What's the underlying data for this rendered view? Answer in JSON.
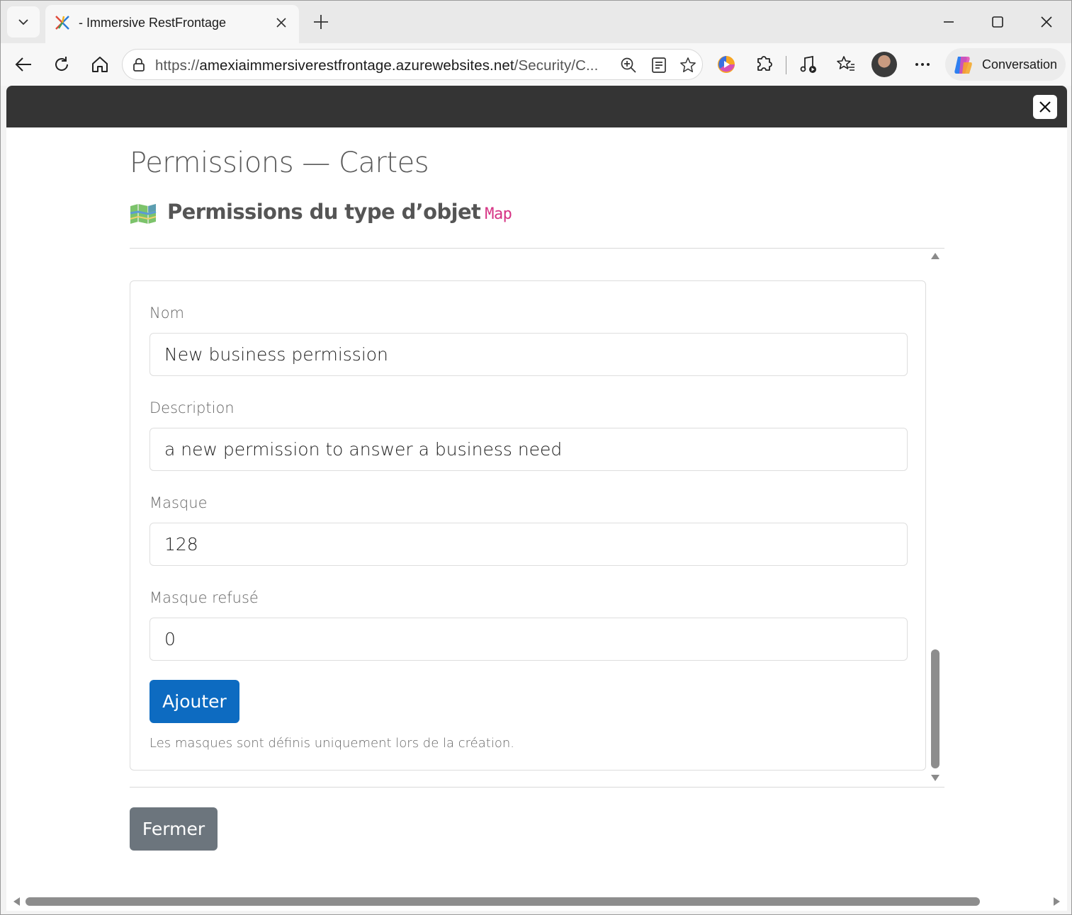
{
  "browser": {
    "tab_title": "- Immersive RestFrontage",
    "url_scheme": "https://",
    "url_host": "amexiaimmersiverestfrontage.azurewebsites.net",
    "url_path": "/Security/C...",
    "conversation_label": "Conversation",
    "icons": [
      "tab-list-icon",
      "app-favicon",
      "close-icon",
      "plus-icon",
      "minimize-icon",
      "maximize-icon",
      "close-window-icon",
      "back-icon",
      "refresh-icon",
      "home-icon",
      "lock-icon",
      "zoom-icon",
      "reader-icon",
      "star-icon",
      "extension-icon",
      "puzzle-icon",
      "media-icon",
      "favorites-icon",
      "more-icon",
      "copilot-icon"
    ]
  },
  "page": {
    "title": "Permissions — Cartes",
    "heading": "Permissions du type d’objet",
    "heading_code": "Map",
    "form": {
      "name_label": "Nom",
      "name_value": "New business permission",
      "description_label": "Description",
      "description_value": "a new permission to answer a business need",
      "mask_label": "Masque",
      "mask_value": "128",
      "denied_mask_label": "Masque refusé",
      "denied_mask_value": "0",
      "add_button": "Ajouter",
      "note": "Les masques sont définis uniquement lors de la création."
    },
    "close_button": "Fermer"
  },
  "colors": {
    "primary": "#0d6bc1",
    "secondary": "#6c757d",
    "code": "#d63384",
    "topbar": "#343434"
  }
}
